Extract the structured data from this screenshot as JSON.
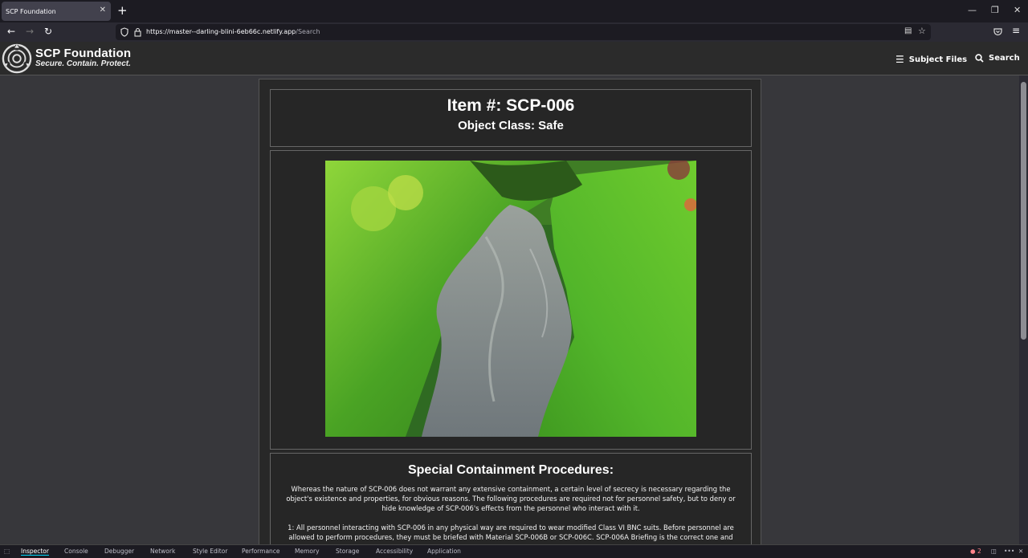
{
  "browser": {
    "tab_title": "SCP Foundation",
    "url_host": "https://master--darling-blini-6eb66c.netlify.app",
    "url_path": "/Search"
  },
  "site": {
    "brand_title": "SCP Foundation",
    "brand_subtitle": "Secure. Contain. Protect.",
    "nav_subject_files": "Subject Files",
    "nav_search": "Search"
  },
  "item": {
    "number": "Item #: SCP-006",
    "object_class": "Object Class: Safe",
    "procedures_heading": "Special Containment Procedures:",
    "procedures_p1": "Whereas the nature of SCP-006 does not warrant any extensive containment, a certain level of secrecy is necessary regarding the object's existence and properties, for obvious reasons. The following procedures are required not for personnel safety, but to deny or hide knowledge of SCP-006's effects from the personnel who interact with it.",
    "procedures_p2": "1: All personnel interacting with SCP-006 in any physical way are required to wear modified Class VI BNC suits. Before personnel are allowed to perform procedures, they must be briefed with Material SCP-006B or SCP-006C. SCP-006A Briefing is the correct one and"
  },
  "devtools": {
    "tabs": [
      "Inspector",
      "Console",
      "Debugger",
      "Network",
      "Style Editor",
      "Performance",
      "Memory",
      "Storage",
      "Accessibility",
      "Application"
    ],
    "error_count": "2"
  },
  "icons": [
    "back-icon",
    "forward-icon",
    "reload-icon",
    "shield-icon",
    "lock-icon",
    "reader-icon",
    "star-icon",
    "pocket-icon",
    "menu-icon",
    "scp-logo-icon",
    "hamburger-icon",
    "search-icon"
  ]
}
